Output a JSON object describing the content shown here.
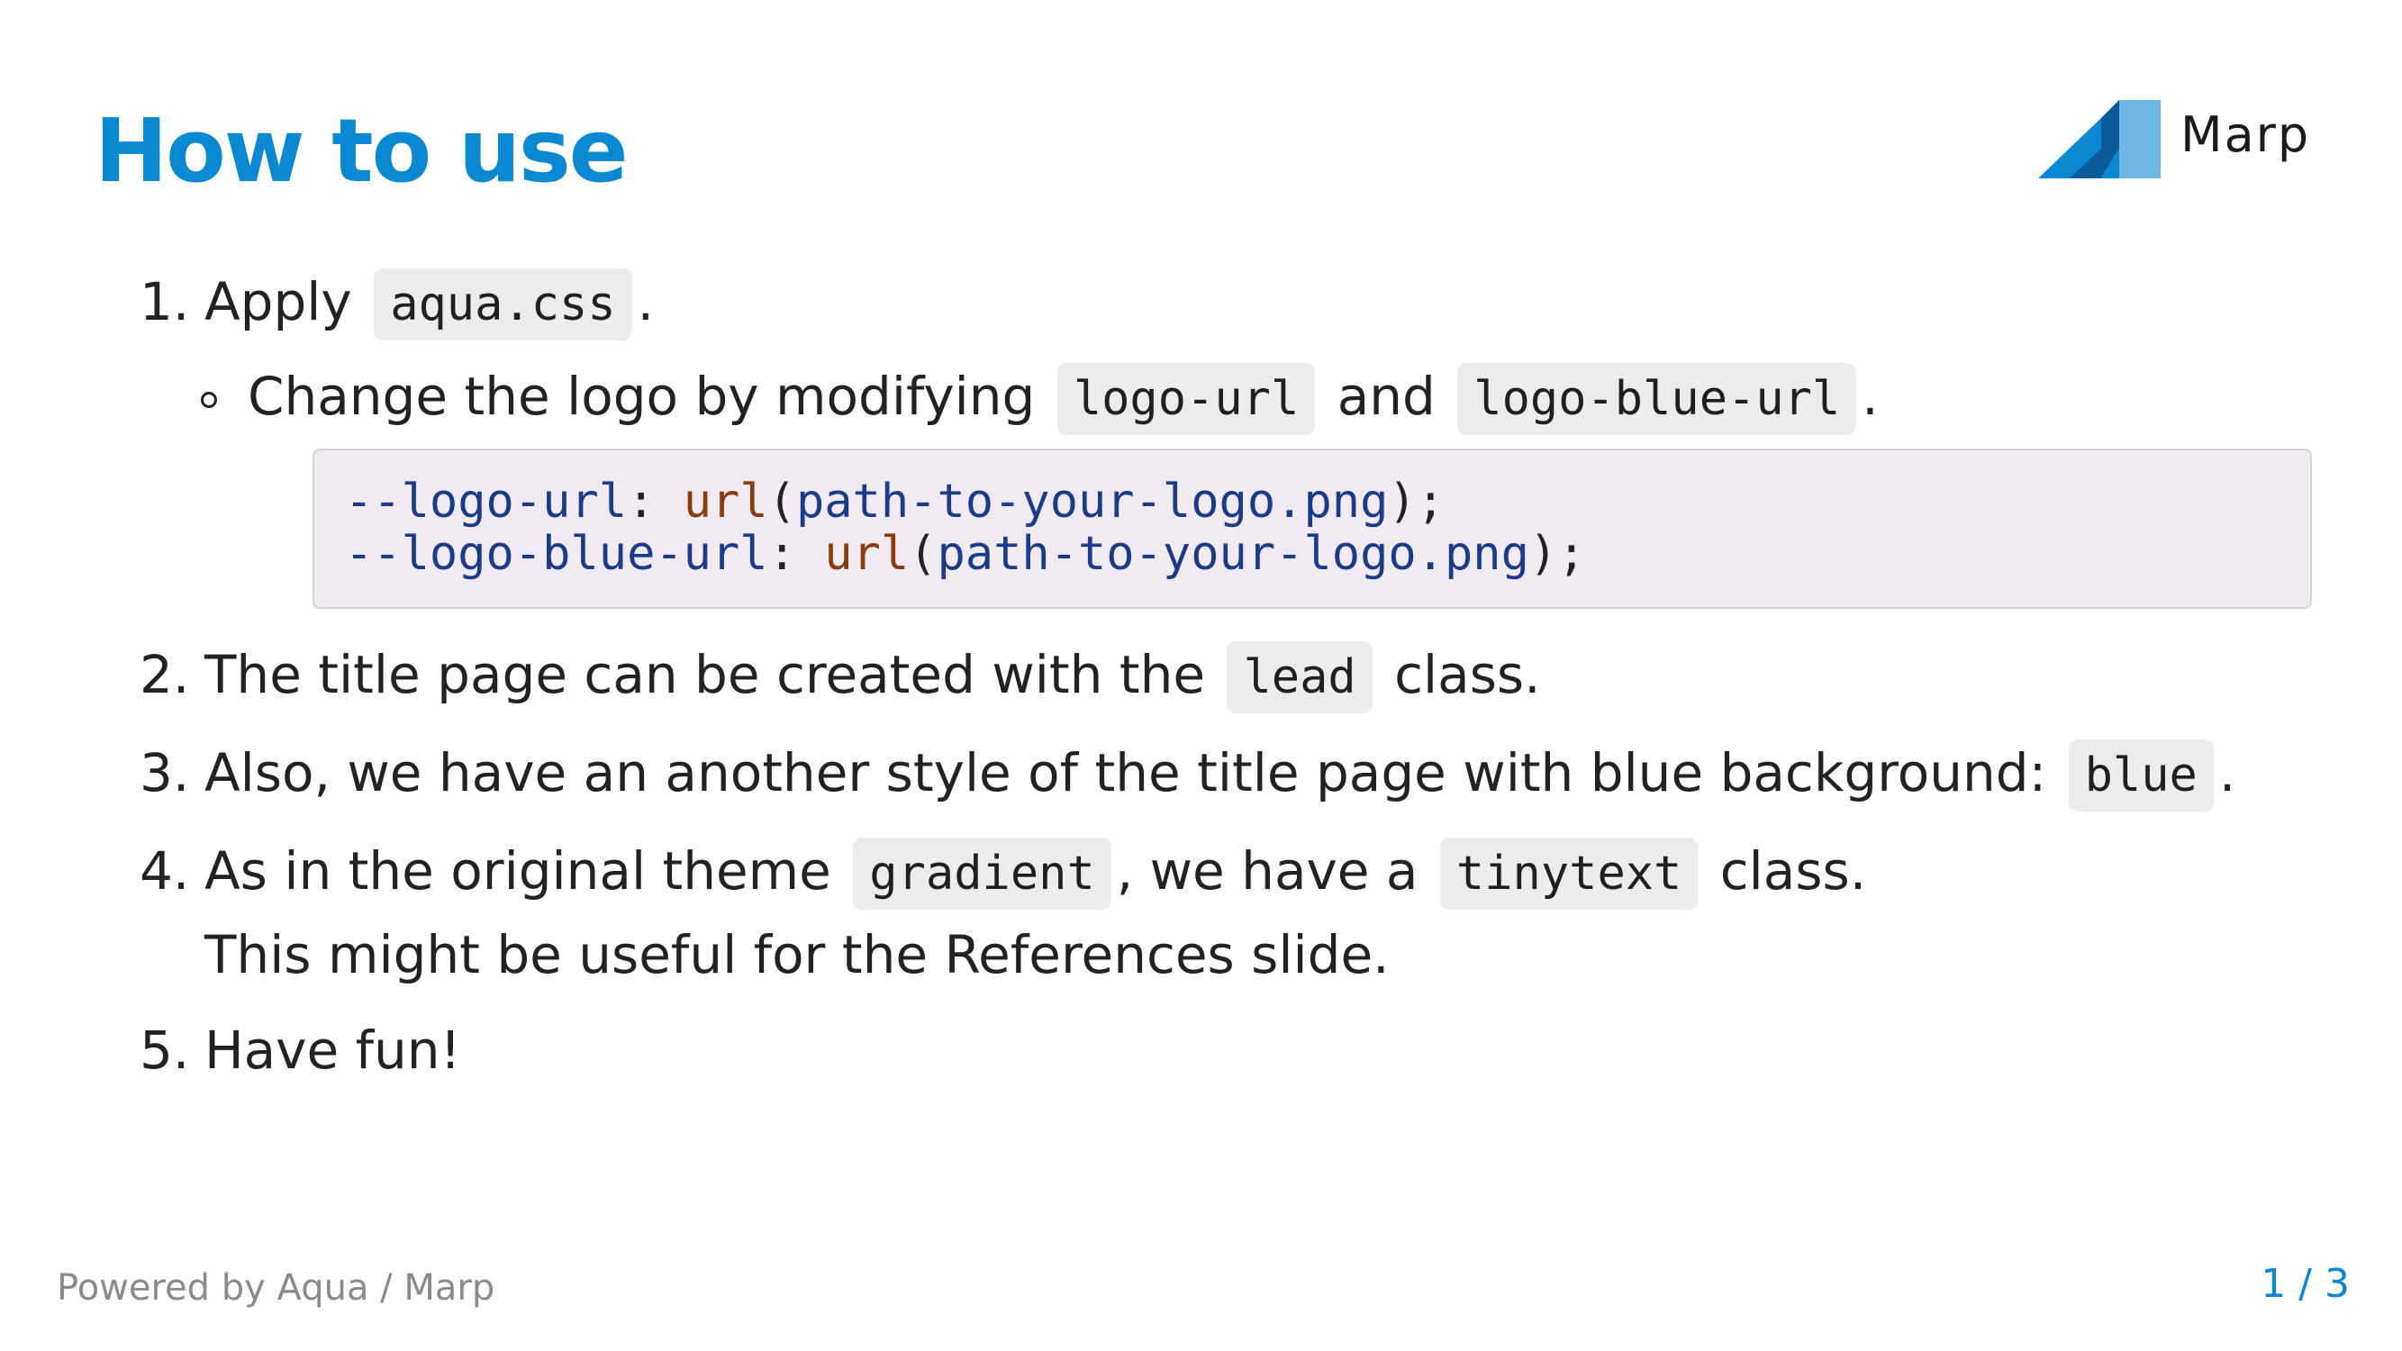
{
  "slide": {
    "title": "How to use",
    "logo_text": "Marp",
    "items": [
      {
        "num": "1.",
        "text_before": "Apply",
        "code": "aqua.css",
        "text_after": ".",
        "sub": {
          "text_before": "Change the logo by modifying",
          "code1": "logo-url",
          "text_mid": "and",
          "code2": "logo-blue-url",
          "text_after": "."
        },
        "code_block": {
          "line1": {
            "prop": "--logo-url",
            "sep": ": ",
            "fn": "url",
            "arg": "path-to-your-logo.png",
            "end": ");"
          },
          "line2": {
            "prop": "--logo-blue-url",
            "sep": ": ",
            "fn": "url",
            "arg": "path-to-your-logo.png",
            "end": ");"
          }
        }
      },
      {
        "num": "2.",
        "text_before": "The title page can be created with the",
        "code": "lead",
        "text_after": "class."
      },
      {
        "num": "3.",
        "text_before": "Also, we have an another style of the title page with blue background:",
        "code": "blue",
        "text_after": "."
      },
      {
        "num": "4.",
        "text_before": "As in the original theme",
        "code1": "gradient",
        "text_mid": ", we have a",
        "code2": "tinytext",
        "text_after": "class.",
        "line2": "This might be useful for the References slide."
      },
      {
        "num": "5.",
        "text": "Have fun!"
      }
    ],
    "footer": "Powered by Aqua / Marp",
    "page": "1 / 3"
  },
  "colors": {
    "accent": "#0a89d2",
    "logo_dark": "#0a5a9c",
    "logo_mid": "#0a89d2",
    "logo_light": "#6fb8e3",
    "code_bg": "#f2eaf2",
    "inline_code_bg": "#ececec"
  }
}
